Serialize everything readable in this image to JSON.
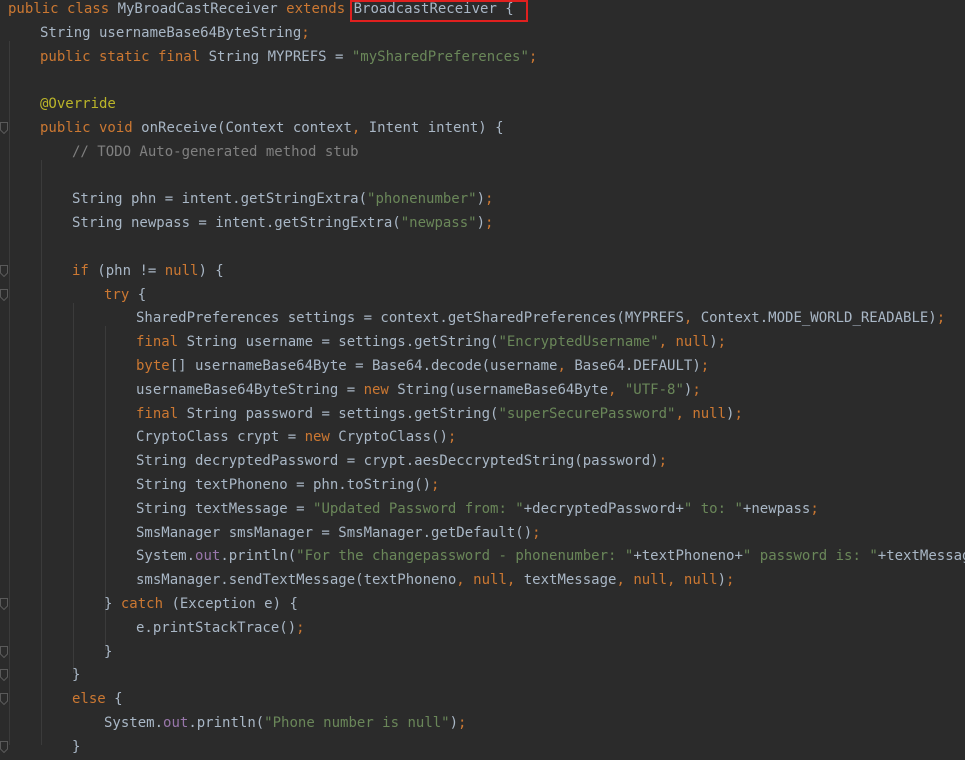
{
  "editor": {
    "theme_colors": {
      "background": "#2b2b2b",
      "keyword": "#cc7832",
      "string": "#6a8759",
      "comment": "#808080",
      "annotation": "#bbb529",
      "text": "#a9b7c6",
      "highlight_box": "#e0201f"
    },
    "highlighted_token": "BroadcastReceiver {",
    "lines": [
      {
        "indent": 0,
        "fold": false,
        "tokens": [
          [
            "kw",
            "public class "
          ],
          [
            "id",
            "MyBroadCastReceiver "
          ],
          [
            "kw",
            "extends "
          ],
          [
            "hl",
            "BroadcastReceiver {"
          ]
        ]
      },
      {
        "indent": 1,
        "fold": false,
        "tokens": [
          [
            "id",
            "String usernameBase64ByteString"
          ],
          [
            "punc",
            ";"
          ]
        ]
      },
      {
        "indent": 1,
        "fold": false,
        "tokens": [
          [
            "kw",
            "public static final "
          ],
          [
            "id",
            "String MYPREFS = "
          ],
          [
            "str",
            "\"mySharedPreferences\""
          ],
          [
            "punc",
            ";"
          ]
        ]
      },
      {
        "indent": 0,
        "fold": false,
        "tokens": []
      },
      {
        "indent": 1,
        "fold": false,
        "tokens": [
          [
            "ann",
            "@Override"
          ]
        ]
      },
      {
        "indent": 1,
        "fold": true,
        "tokens": [
          [
            "kw",
            "public void "
          ],
          [
            "id",
            "onReceive(Context context"
          ],
          [
            "punc",
            ", "
          ],
          [
            "id",
            "Intent intent) {"
          ]
        ]
      },
      {
        "indent": 2,
        "fold": false,
        "tokens": [
          [
            "com",
            "// TODO Auto-generated method stub"
          ]
        ]
      },
      {
        "indent": 0,
        "fold": false,
        "tokens": []
      },
      {
        "indent": 2,
        "fold": false,
        "tokens": [
          [
            "id",
            "String phn = intent.getStringExtra("
          ],
          [
            "str",
            "\"phonenumber\""
          ],
          [
            "id",
            ")"
          ],
          [
            "punc",
            ";"
          ]
        ]
      },
      {
        "indent": 2,
        "fold": false,
        "tokens": [
          [
            "id",
            "String newpass = intent.getStringExtra("
          ],
          [
            "str",
            "\"newpass\""
          ],
          [
            "id",
            ")"
          ],
          [
            "punc",
            ";"
          ]
        ]
      },
      {
        "indent": 0,
        "fold": false,
        "tokens": []
      },
      {
        "indent": 2,
        "fold": true,
        "tokens": [
          [
            "kw",
            "if "
          ],
          [
            "id",
            "(phn != "
          ],
          [
            "kw",
            "null"
          ],
          [
            "id",
            ") {"
          ]
        ]
      },
      {
        "indent": 3,
        "fold": true,
        "tokens": [
          [
            "kw",
            "try "
          ],
          [
            "id",
            "{"
          ]
        ]
      },
      {
        "indent": 4,
        "fold": false,
        "tokens": [
          [
            "id",
            "SharedPreferences settings = context.getSharedPreferences(MYPREFS"
          ],
          [
            "punc",
            ", "
          ],
          [
            "id",
            "Context.MODE_WORLD_READABLE)"
          ],
          [
            "punc",
            ";"
          ]
        ]
      },
      {
        "indent": 4,
        "fold": false,
        "tokens": [
          [
            "kw",
            "final "
          ],
          [
            "id",
            "String username = settings.getString("
          ],
          [
            "str",
            "\"EncryptedUsername\""
          ],
          [
            "punc",
            ", "
          ],
          [
            "kw",
            "null"
          ],
          [
            "id",
            ")"
          ],
          [
            "punc",
            ";"
          ]
        ]
      },
      {
        "indent": 4,
        "fold": false,
        "tokens": [
          [
            "kw",
            "byte"
          ],
          [
            "id",
            "[] usernameBase64Byte = Base64.decode(username"
          ],
          [
            "punc",
            ", "
          ],
          [
            "id",
            "Base64.DEFAULT)"
          ],
          [
            "punc",
            ";"
          ]
        ]
      },
      {
        "indent": 4,
        "fold": false,
        "tokens": [
          [
            "id",
            "usernameBase64ByteString = "
          ],
          [
            "kw",
            "new "
          ],
          [
            "id",
            "String(usernameBase64Byte"
          ],
          [
            "punc",
            ", "
          ],
          [
            "str",
            "\"UTF-8\""
          ],
          [
            "id",
            ")"
          ],
          [
            "punc",
            ";"
          ]
        ]
      },
      {
        "indent": 4,
        "fold": false,
        "tokens": [
          [
            "kw",
            "final "
          ],
          [
            "id",
            "String password = settings.getString("
          ],
          [
            "str",
            "\"superSecurePassword\""
          ],
          [
            "punc",
            ", "
          ],
          [
            "kw",
            "null"
          ],
          [
            "id",
            ")"
          ],
          [
            "punc",
            ";"
          ]
        ]
      },
      {
        "indent": 4,
        "fold": false,
        "tokens": [
          [
            "id",
            "CryptoClass crypt = "
          ],
          [
            "kw",
            "new "
          ],
          [
            "id",
            "CryptoClass()"
          ],
          [
            "punc",
            ";"
          ]
        ]
      },
      {
        "indent": 4,
        "fold": false,
        "tokens": [
          [
            "id",
            "String decryptedPassword = crypt.aesDeccryptedString(password)"
          ],
          [
            "punc",
            ";"
          ]
        ]
      },
      {
        "indent": 4,
        "fold": false,
        "tokens": [
          [
            "id",
            "String textPhoneno = phn.toString()"
          ],
          [
            "punc",
            ";"
          ]
        ]
      },
      {
        "indent": 4,
        "fold": false,
        "tokens": [
          [
            "id",
            "String textMessage = "
          ],
          [
            "str",
            "\"Updated Password from: \""
          ],
          [
            "id",
            "+decryptedPassword+"
          ],
          [
            "str",
            "\" to: \""
          ],
          [
            "id",
            "+newpass"
          ],
          [
            "punc",
            ";"
          ]
        ]
      },
      {
        "indent": 4,
        "fold": false,
        "tokens": [
          [
            "id",
            "SmsManager smsManager = SmsManager.getDefault()"
          ],
          [
            "punc",
            ";"
          ]
        ]
      },
      {
        "indent": 4,
        "fold": false,
        "tokens": [
          [
            "id",
            "System."
          ],
          [
            "field",
            "out"
          ],
          [
            "id",
            ".println("
          ],
          [
            "str",
            "\"For the changepassword - phonenumber: \""
          ],
          [
            "id",
            "+textPhoneno+"
          ],
          [
            "str",
            "\" password is: \""
          ],
          [
            "id",
            "+textMessage)"
          ],
          [
            "punc",
            ";"
          ]
        ]
      },
      {
        "indent": 4,
        "fold": false,
        "tokens": [
          [
            "id",
            "smsManager.sendTextMessage(textPhoneno"
          ],
          [
            "punc",
            ", "
          ],
          [
            "kw",
            "null"
          ],
          [
            "punc",
            ", "
          ],
          [
            "id",
            "textMessage"
          ],
          [
            "punc",
            ", "
          ],
          [
            "kw",
            "null"
          ],
          [
            "punc",
            ", "
          ],
          [
            "kw",
            "null"
          ],
          [
            "id",
            ")"
          ],
          [
            "punc",
            ";"
          ]
        ]
      },
      {
        "indent": 3,
        "fold": true,
        "tokens": [
          [
            "id",
            "} "
          ],
          [
            "kw",
            "catch "
          ],
          [
            "id",
            "(Exception e) {"
          ]
        ]
      },
      {
        "indent": 4,
        "fold": false,
        "tokens": [
          [
            "id",
            "e.printStackTrace()"
          ],
          [
            "punc",
            ";"
          ]
        ]
      },
      {
        "indent": 3,
        "fold": true,
        "tokens": [
          [
            "id",
            "}"
          ]
        ]
      },
      {
        "indent": 2,
        "fold": true,
        "tokens": [
          [
            "id",
            "}"
          ]
        ]
      },
      {
        "indent": 2,
        "fold": true,
        "tokens": [
          [
            "kw",
            "else "
          ],
          [
            "id",
            "{"
          ]
        ]
      },
      {
        "indent": 3,
        "fold": false,
        "tokens": [
          [
            "id",
            "System."
          ],
          [
            "field",
            "out"
          ],
          [
            "id",
            ".println("
          ],
          [
            "str",
            "\"Phone number is null\""
          ],
          [
            "id",
            ")"
          ],
          [
            "punc",
            ";"
          ]
        ]
      },
      {
        "indent": 2,
        "fold": true,
        "tokens": [
          [
            "id",
            "}"
          ]
        ]
      }
    ]
  }
}
